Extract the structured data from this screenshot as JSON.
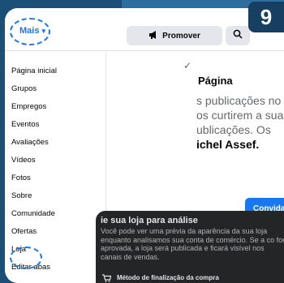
{
  "step_badge": "9",
  "header": {
    "more_label": "Mais",
    "more_caret": "▾",
    "promote_label": "Promover"
  },
  "menu": {
    "items": [
      "Página inicial",
      "Grupos",
      "Empregos",
      "Eventos",
      "Avaliações",
      "Vídeos",
      "Fotos",
      "Sobre",
      "Comunidade",
      "Ofertas",
      "Loja",
      "Editar abas"
    ],
    "checked_item": "Página inicial"
  },
  "page_panel": {
    "title": "Página",
    "lines": [
      "s publicações no",
      "os curtirem a sua",
      "ublicações. Os",
      "ichel Assef."
    ],
    "invite_label": "Convidar"
  },
  "shop_overlay": {
    "title": "ie sua loja para análise",
    "description": "Você pode ver uma prévia da aparência da sua loja enquanto analisamos sua conta de comércio. Se a co for aprovada, a loja será publicada e ficará visível nos canais de vendas.",
    "row_label": "Método de finalização da compra"
  },
  "colors": {
    "background": "#1b4f78",
    "accent": "#1877f2",
    "overlay": "#242526",
    "badge": "#173f61"
  }
}
